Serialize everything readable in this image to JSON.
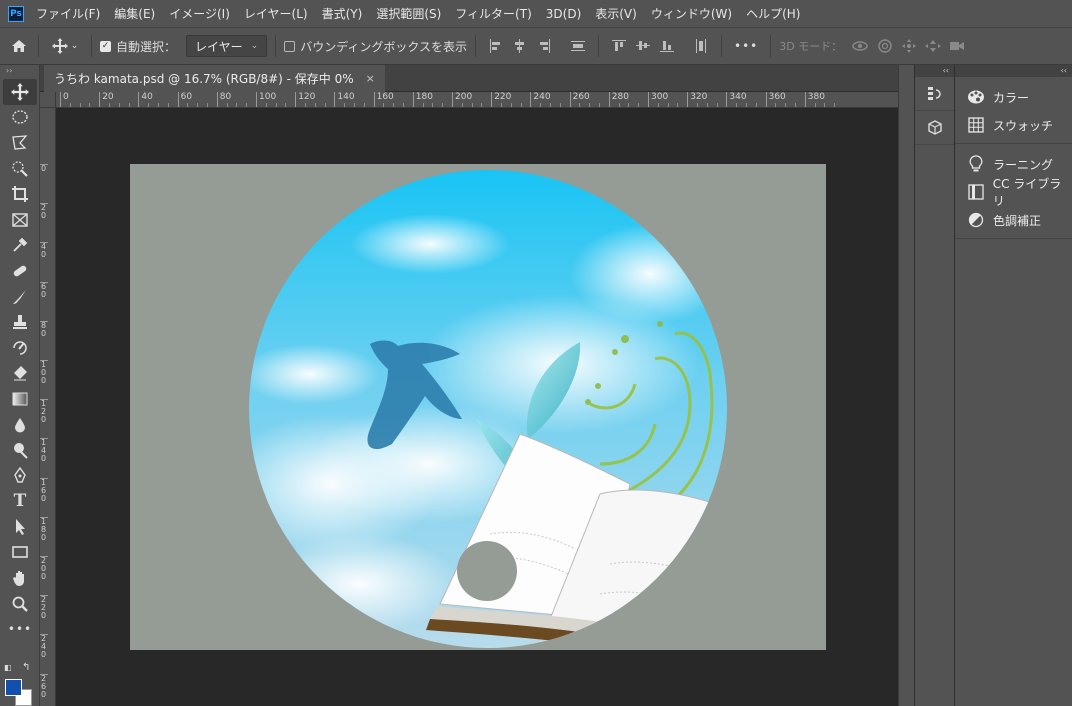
{
  "app": {
    "logo": "Ps"
  },
  "menu": [
    "ファイル(F)",
    "編集(E)",
    "イメージ(I)",
    "レイヤー(L)",
    "書式(Y)",
    "選択範囲(S)",
    "フィルター(T)",
    "3D(D)",
    "表示(V)",
    "ウィンドウ(W)",
    "ヘルプ(H)"
  ],
  "options": {
    "auto_select_label": "自動選択：",
    "auto_select_checked": true,
    "target_value": "レイヤー",
    "bounding_box_label": "バウンディングボックスを表示",
    "bounding_box_checked": false,
    "more": "•••",
    "mode_3d_label": "3D モード："
  },
  "document": {
    "tab_title": "うちわ kamata.psd @ 16.7% (RGB/8#) - 保存中 0%",
    "close": "×"
  },
  "ruler": {
    "h_labels": [
      "0",
      "20",
      "40",
      "60",
      "80",
      "100",
      "120",
      "140",
      "160",
      "180",
      "200",
      "220",
      "240",
      "260",
      "280",
      "300",
      "320",
      "340",
      "360",
      "380"
    ],
    "v_labels": [
      "0",
      "2 0",
      "4 0",
      "6 0",
      "8 0",
      "1 0 0",
      "1 2 0",
      "1 4 0",
      "1 6 0",
      "1 8 0",
      "2 0 0",
      "2 2 0",
      "2 4 0",
      "2 6 0"
    ]
  },
  "panels": {
    "group1": [
      {
        "label": "カラー",
        "icon": "palette-icon"
      },
      {
        "label": "スウォッチ",
        "icon": "swatches-icon"
      }
    ],
    "group2": [
      {
        "label": "ラーニング",
        "icon": "lightbulb-icon"
      },
      {
        "label": "CC ライブラリ",
        "icon": "library-icon"
      },
      {
        "label": "色調補正",
        "icon": "adjustments-icon"
      }
    ]
  },
  "colors": {
    "foreground": "#1350ad",
    "background": "#ffffff",
    "canvas_bg": "#959b95"
  }
}
